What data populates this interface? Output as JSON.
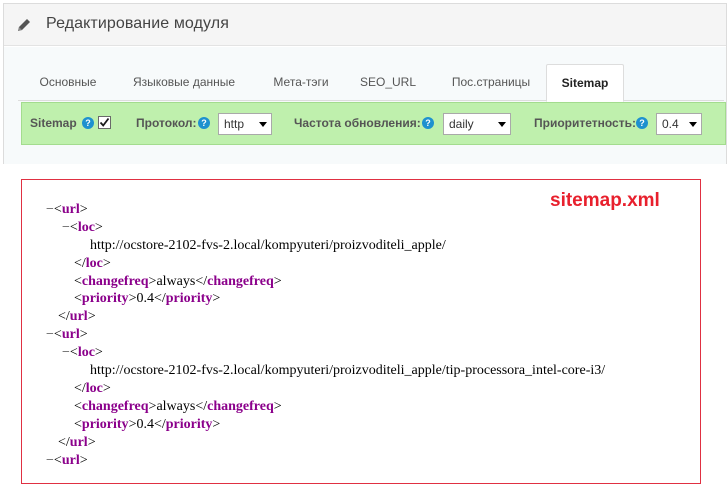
{
  "header": {
    "title": "Редактирование модуля",
    "icon": "pencil-icon"
  },
  "tabs": [
    {
      "label": "Основные",
      "active": false
    },
    {
      "label": "Языковые данные",
      "active": false
    },
    {
      "label": "Мета-тэги",
      "active": false
    },
    {
      "label": "SEO_URL",
      "active": false
    },
    {
      "label": "Пос.страницы",
      "active": false
    },
    {
      "label": "Sitemap",
      "active": true
    }
  ],
  "sitemap_bar": {
    "sitemap_label": "Sitemap",
    "sitemap_checked": true,
    "protocol_label": "Протокол:",
    "protocol_value": "http",
    "changefreq_label": "Частота обновления:",
    "changefreq_value": "daily",
    "priority_label": "Приоритетность:",
    "priority_value": "0.4",
    "help_glyph": "?",
    "bar_color": "#bff0ad"
  },
  "xml": {
    "file_label": "sitemap.xml",
    "minus": "−",
    "lt": "<",
    "gt": ">",
    "lt_slash": "</",
    "tag_url": "url",
    "tag_loc": "loc",
    "tag_changefreq": "changefreq",
    "tag_priority": "priority",
    "entries": [
      {
        "loc": "http://ocstore-2102-fvs-2.local/kompyuteri/proizvoditeli_apple/",
        "changefreq": "always",
        "priority": "0.4"
      },
      {
        "loc": "http://ocstore-2102-fvs-2.local/kompyuteri/proizvoditeli_apple/tip-processora_intel-core-i3/",
        "changefreq": "always",
        "priority": "0.4"
      }
    ],
    "tag_color": "#8b008b",
    "border_color": "#e03042"
  }
}
